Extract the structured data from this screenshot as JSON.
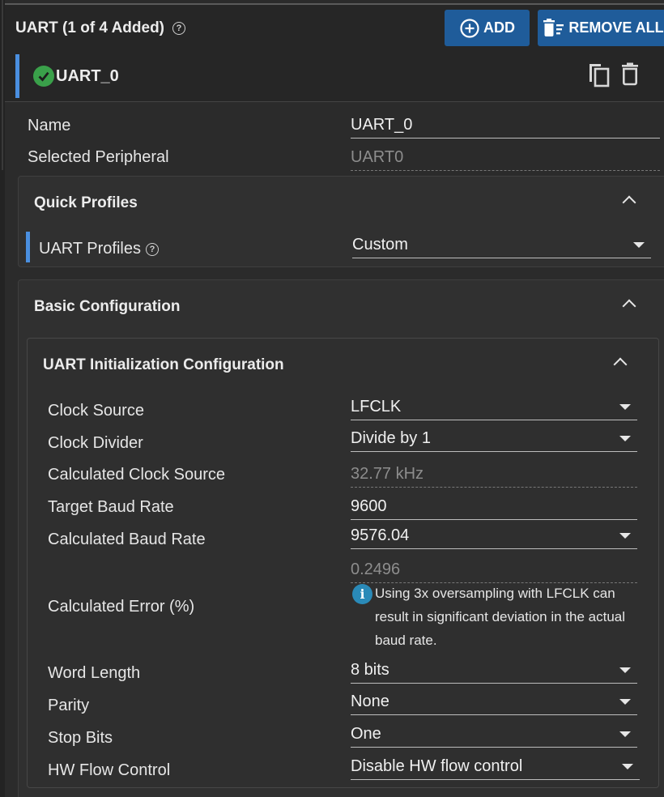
{
  "header": {
    "title": "UART (1 of 4 Added)",
    "add_label": "ADD",
    "remove_all_label": "REMOVE ALL"
  },
  "instance": {
    "name": "UART_0"
  },
  "top_fields": {
    "name_label": "Name",
    "name_value": "UART_0",
    "peripheral_label": "Selected Peripheral",
    "peripheral_value": "UART0"
  },
  "quick_profiles": {
    "title": "Quick Profiles",
    "profiles_label": "UART Profiles",
    "profiles_value": "Custom"
  },
  "basic_config": {
    "title": "Basic Configuration",
    "init_title": "UART Initialization Configuration",
    "fields": [
      {
        "label": "Clock Source",
        "value": "LFCLK"
      },
      {
        "label": "Clock Divider",
        "value": "Divide by 1"
      },
      {
        "label": "Calculated Clock Source",
        "value": "32.77 kHz"
      },
      {
        "label": "Target Baud Rate",
        "value": "9600"
      },
      {
        "label": "Calculated Baud Rate",
        "value": "9576.04"
      },
      {
        "label": "Calculated Error (%)",
        "value": "0.2496"
      },
      {
        "label": "Word Length",
        "value": "8 bits"
      },
      {
        "label": "Parity",
        "value": "None"
      },
      {
        "label": "Stop Bits",
        "value": "One"
      },
      {
        "label": "HW Flow Control",
        "value": "Disable HW flow control"
      }
    ],
    "error_note": "Using 3x oversampling with LFCLK can result in significant deviation in the actual baud rate."
  }
}
